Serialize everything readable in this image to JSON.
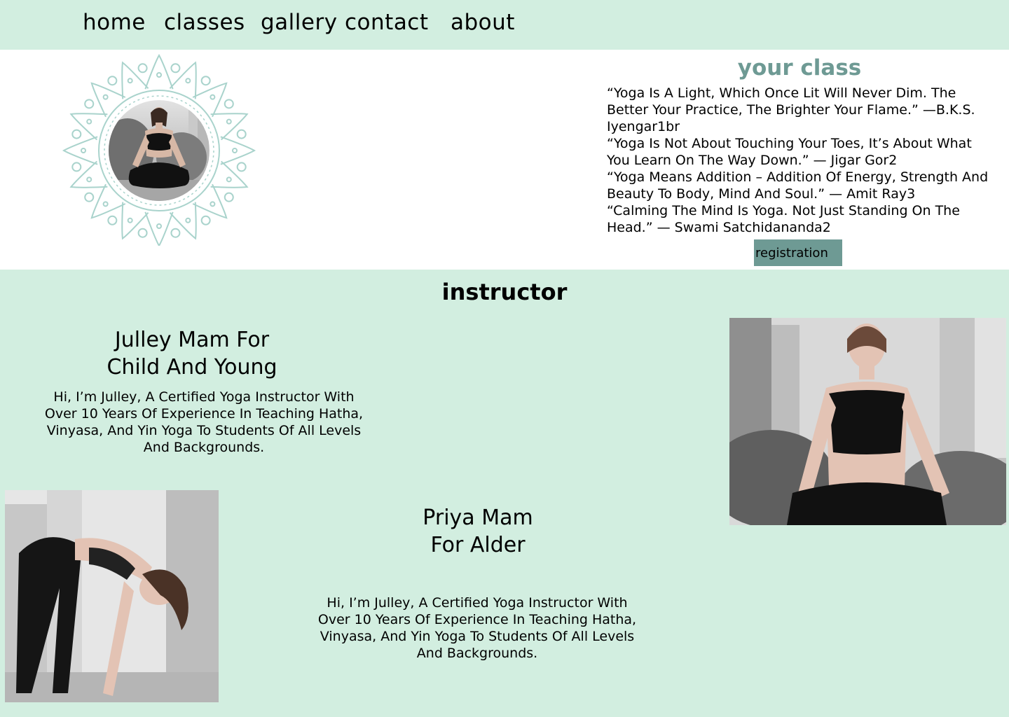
{
  "nav": {
    "items": [
      {
        "label": "home"
      },
      {
        "label": "classes"
      },
      {
        "label": "gallery"
      },
      {
        "label": "contact"
      },
      {
        "label": "about"
      }
    ]
  },
  "class_section": {
    "title": "your class",
    "quotes": [
      "“Yoga Is A Light, Which Once Lit Will Never Dim. The Better Your Practice, The Brighter Your Flame.” —B.K.S. Iyengar1br",
      "“Yoga Is Not About Touching Your Toes, It’s About What You Learn On The Way Down.” — Jigar Gor2",
      "“Yoga Means Addition – Addition Of Energy, Strength And Beauty To Body, Mind And Soul.” — Amit Ray3",
      "“Calming The Mind Is Yoga. Not Just Standing On The Head.” — Swami Satchidananda2"
    ],
    "button_label": "registration"
  },
  "instructors": {
    "title": "instructor",
    "list": [
      {
        "name_line1": "Julley Mam For",
        "name_line2": "Child And Young",
        "bio": "Hi, I’m Julley, A Certified Yoga Instructor With Over 10 Years Of Experience In Teaching Hatha, Vinyasa, And Yin Yoga To Students Of All Levels And Backgrounds."
      },
      {
        "name_line1": "Priya Mam",
        "name_line2": "For Alder",
        "bio": "Hi, I’m Julley, A Certified Yoga Instructor With Over 10 Years Of Experience In Teaching Hatha, Vinyasa, And Yin Yoga To Students Of All Levels And Backgrounds."
      }
    ]
  },
  "colors": {
    "mint": "#d2eee0",
    "accent": "#6e9a94",
    "mandala": "#a9d3cc"
  }
}
